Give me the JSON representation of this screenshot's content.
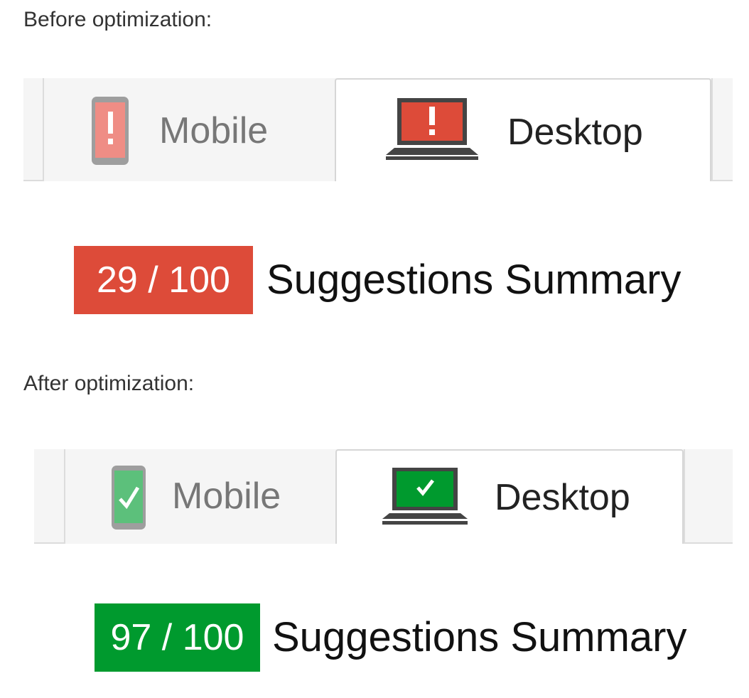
{
  "before": {
    "caption": "Before optimization:",
    "tabs": {
      "mobile": {
        "label": "Mobile",
        "status": "warning",
        "icon": "mobile-warning-icon"
      },
      "desktop": {
        "label": "Desktop",
        "status": "warning",
        "icon": "desktop-warning-icon",
        "active": true
      }
    },
    "score": {
      "value": "29 / 100",
      "badge_color": "#dd4b39"
    },
    "summary_label": "Suggestions Summary"
  },
  "after": {
    "caption": "After optimization:",
    "tabs": {
      "mobile": {
        "label": "Mobile",
        "status": "pass",
        "icon": "mobile-check-icon"
      },
      "desktop": {
        "label": "Desktop",
        "status": "pass",
        "icon": "desktop-check-icon",
        "active": true
      }
    },
    "score": {
      "value": "97 / 100",
      "badge_color": "#009a2e"
    },
    "summary_label": "Suggestions Summary"
  },
  "colors": {
    "warning": "#dd4b39",
    "warning_light": "#ef8d85",
    "pass": "#009a2e",
    "pass_light": "#5cc07b",
    "device_gray": "#888888"
  }
}
